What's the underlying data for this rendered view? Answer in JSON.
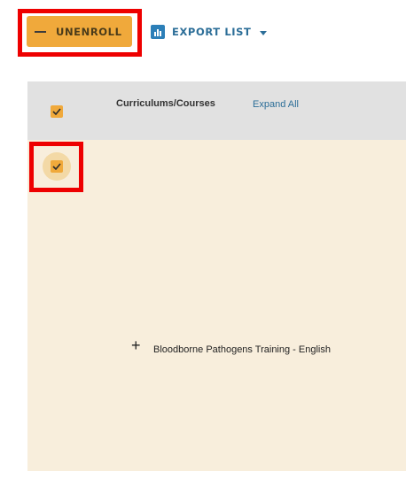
{
  "toolbar": {
    "unenroll_label": "UNENROLL",
    "export_label": "EXPORT LIST"
  },
  "table": {
    "header_title": "Curriculums/Courses",
    "expand_all_label": "Expand All",
    "header_checked": true,
    "rows": [
      {
        "checked": true,
        "expand_symbol": "+",
        "course_name": "Bloodborne Pathogens Training - English"
      }
    ]
  },
  "colors": {
    "accent_orange": "#f0a93b",
    "link_blue": "#2c6e98",
    "highlight_red": "#ee0000",
    "row_background": "#f8eedc",
    "header_background": "#e1e1e1"
  },
  "icons": {
    "unenroll": "minus-icon",
    "export": "bar-chart-icon",
    "dropdown": "caret-down-icon",
    "checkbox": "checkmark-icon",
    "expand": "plus-icon"
  }
}
